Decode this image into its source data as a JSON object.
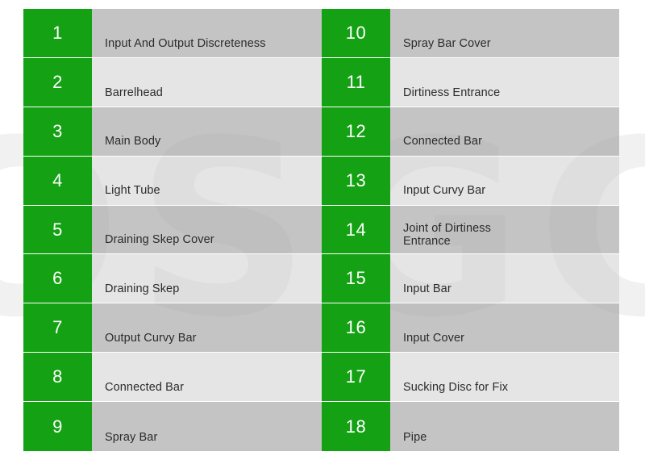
{
  "watermark": {
    "text": "OSGC"
  },
  "colors": {
    "green": "#14a114",
    "row_dark": "#bdbdbd",
    "row_light": "#dcdcdc",
    "text": "#2b2b2b",
    "number_text": "#ffffff"
  },
  "table": {
    "left_column": [
      {
        "number": "1",
        "label": "Input And Output Discreteness"
      },
      {
        "number": "2",
        "label": "Barrelhead"
      },
      {
        "number": "3",
        "label": "Main Body"
      },
      {
        "number": "4",
        "label": "Light Tube"
      },
      {
        "number": "5",
        "label": "Draining Skep Cover"
      },
      {
        "number": "6",
        "label": "Draining Skep"
      },
      {
        "number": "7",
        "label": "Output Curvy Bar"
      },
      {
        "number": "8",
        "label": "Connected Bar"
      },
      {
        "number": "9",
        "label": "Spray Bar"
      }
    ],
    "right_column": [
      {
        "number": "10",
        "label": "Spray Bar Cover"
      },
      {
        "number": "11",
        "label": "Dirtiness Entrance"
      },
      {
        "number": "12",
        "label": "Connected Bar"
      },
      {
        "number": "13",
        "label": "Input Curvy Bar"
      },
      {
        "number": "14",
        "label": "Joint of Dirtiness",
        "label_line2": "Entrance"
      },
      {
        "number": "15",
        "label": "Input Bar"
      },
      {
        "number": "16",
        "label": "Input Cover"
      },
      {
        "number": "17",
        "label": "Sucking Disc for Fix"
      },
      {
        "number": "18",
        "label": "Pipe"
      }
    ]
  }
}
